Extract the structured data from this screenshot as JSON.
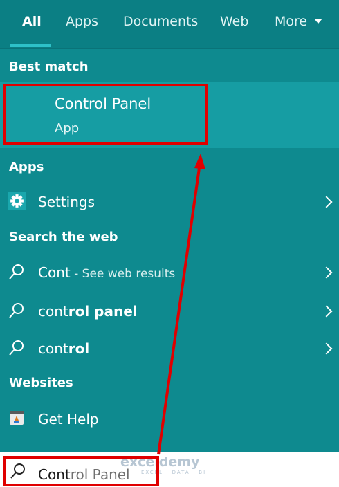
{
  "tabs": [
    {
      "label": "All",
      "active": true
    },
    {
      "label": "Apps"
    },
    {
      "label": "Documents"
    },
    {
      "label": "Web"
    },
    {
      "label": "More"
    }
  ],
  "sections": {
    "best_match": "Best match",
    "apps": "Apps",
    "search_web": "Search the web",
    "websites": "Websites"
  },
  "best_match": {
    "title": "Control Panel",
    "subtitle": "App",
    "icon": "control-panel-icon"
  },
  "apps": [
    {
      "label": "Settings",
      "icon": "gear-icon"
    }
  ],
  "web_results": [
    {
      "label": "Cont",
      "suffix": " - See web results"
    },
    {
      "label_pre": "cont",
      "label_bold": "rol panel"
    },
    {
      "label_pre": "cont",
      "label_bold": "rol"
    }
  ],
  "websites": [
    {
      "label": "Get Help",
      "icon": "get-help-icon"
    }
  ],
  "search": {
    "typed": "Cont",
    "suggestion": "rol Panel"
  },
  "watermark": {
    "name": "exceldemy",
    "tagline": "EXCEL · DATA · BI"
  },
  "colors": {
    "background": "#0e8a8f",
    "highlight": "#169da3",
    "annotation": "#e00000"
  }
}
